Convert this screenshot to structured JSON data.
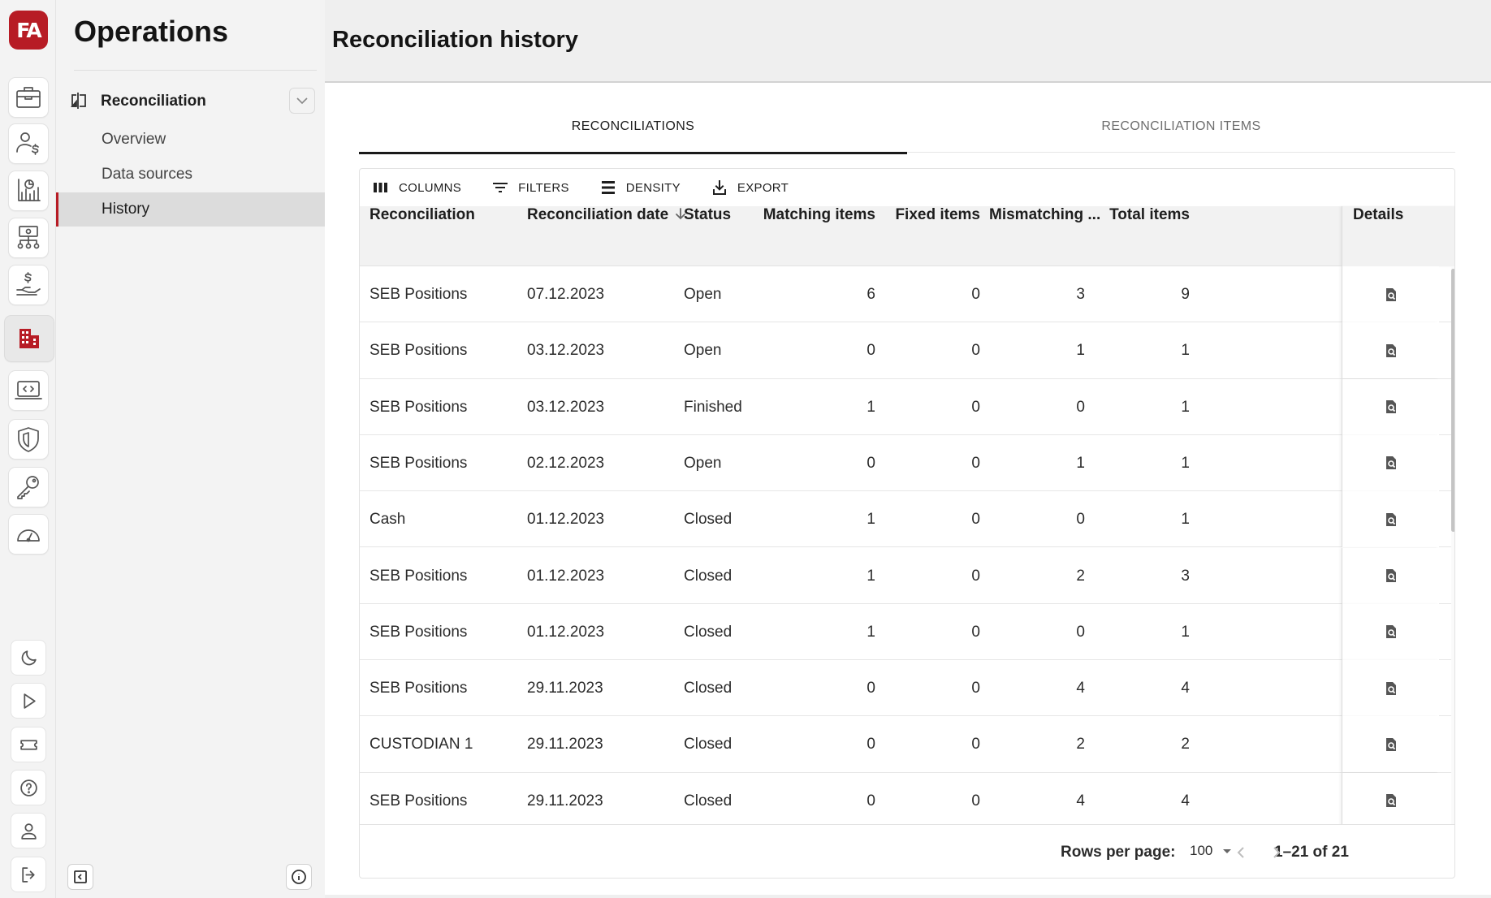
{
  "app": {
    "logo_text": "FA",
    "title": "Operations"
  },
  "rail": {
    "top_icons": [
      "briefcase-icon",
      "client-money-icon",
      "report-icon",
      "structure-icon",
      "payment-hand-icon",
      "building-icon",
      "code-laptop-icon",
      "shield-icon",
      "key-icon",
      "gauge-icon"
    ],
    "active_icon": "building-icon",
    "bottom_icons": [
      "moon-icon",
      "play-icon",
      "ticket-icon",
      "help-icon",
      "user-icon",
      "logout-icon"
    ]
  },
  "sidebar": {
    "section_label": "Reconciliation",
    "items": [
      {
        "label": "Overview",
        "active": false
      },
      {
        "label": "Data sources",
        "active": false
      },
      {
        "label": "History",
        "active": true
      }
    ]
  },
  "page": {
    "title": "Reconciliation history"
  },
  "tabs": [
    {
      "label": "RECONCILIATIONS",
      "active": true
    },
    {
      "label": "RECONCILIATION ITEMS",
      "active": false
    }
  ],
  "toolbar": {
    "columns": "COLUMNS",
    "filters": "FILTERS",
    "density": "DENSITY",
    "export": "EXPORT"
  },
  "table": {
    "columns": [
      "Reconciliation",
      "Reconciliation date",
      "Status",
      "Matching items",
      "Fixed items",
      "Mismatching ...",
      "Total items",
      "Details"
    ],
    "sorted_column": "Reconciliation date",
    "sort_direction": "desc",
    "rows": [
      {
        "name": "SEB Positions",
        "date": "07.12.2023",
        "status": "Open",
        "matching": "6",
        "fixed": "0",
        "mismatching": "3",
        "total": "9"
      },
      {
        "name": "SEB Positions",
        "date": "03.12.2023",
        "status": "Open",
        "matching": "0",
        "fixed": "0",
        "mismatching": "1",
        "total": "1"
      },
      {
        "name": "SEB Positions",
        "date": "03.12.2023",
        "status": "Finished",
        "matching": "1",
        "fixed": "0",
        "mismatching": "0",
        "total": "1"
      },
      {
        "name": "SEB Positions",
        "date": "02.12.2023",
        "status": "Open",
        "matching": "0",
        "fixed": "0",
        "mismatching": "1",
        "total": "1"
      },
      {
        "name": "Cash",
        "date": "01.12.2023",
        "status": "Closed",
        "matching": "1",
        "fixed": "0",
        "mismatching": "0",
        "total": "1"
      },
      {
        "name": "SEB Positions",
        "date": "01.12.2023",
        "status": "Closed",
        "matching": "1",
        "fixed": "0",
        "mismatching": "2",
        "total": "3"
      },
      {
        "name": "SEB Positions",
        "date": "01.12.2023",
        "status": "Closed",
        "matching": "1",
        "fixed": "0",
        "mismatching": "0",
        "total": "1"
      },
      {
        "name": "SEB Positions",
        "date": "29.11.2023",
        "status": "Closed",
        "matching": "0",
        "fixed": "0",
        "mismatching": "4",
        "total": "4"
      },
      {
        "name": "CUSTODIAN 1",
        "date": "29.11.2023",
        "status": "Closed",
        "matching": "0",
        "fixed": "0",
        "mismatching": "2",
        "total": "2"
      },
      {
        "name": "SEB Positions",
        "date": "29.11.2023",
        "status": "Closed",
        "matching": "0",
        "fixed": "0",
        "mismatching": "4",
        "total": "4"
      }
    ]
  },
  "pagination": {
    "rows_per_page_label": "Rows per page:",
    "rows_per_page_value": "100",
    "range_text": "1–21 of 21"
  },
  "colors": {
    "brand": "#b71c25"
  }
}
